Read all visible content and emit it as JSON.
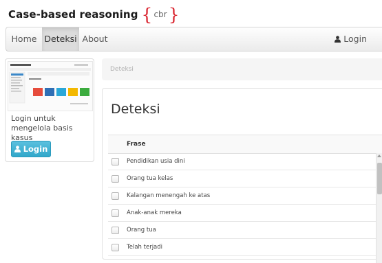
{
  "brand": {
    "title": "Case-based reasoning",
    "abbr": "cbr",
    "accent": "#d9232e"
  },
  "navbar": {
    "items": [
      {
        "label": "Home"
      },
      {
        "label": "Deteksi",
        "active": true
      },
      {
        "label": "About"
      }
    ],
    "login_label": "Login",
    "login_icon": "user-icon"
  },
  "sidebar": {
    "text": "Login untuk mengelola basis kasus",
    "button_label": "Login",
    "button_icon": "user-icon",
    "button_color": "#5bc0de"
  },
  "breadcrumb": {
    "current": "Deteksi"
  },
  "main": {
    "title": "Deteksi",
    "table": {
      "header": "Frase",
      "rows": [
        "Pendidikan usia dini",
        "Orang tua kelas",
        "Kalangan menengah ke atas",
        "Anak-anak mereka",
        "Orang tua",
        "Telah terjadi"
      ]
    }
  }
}
